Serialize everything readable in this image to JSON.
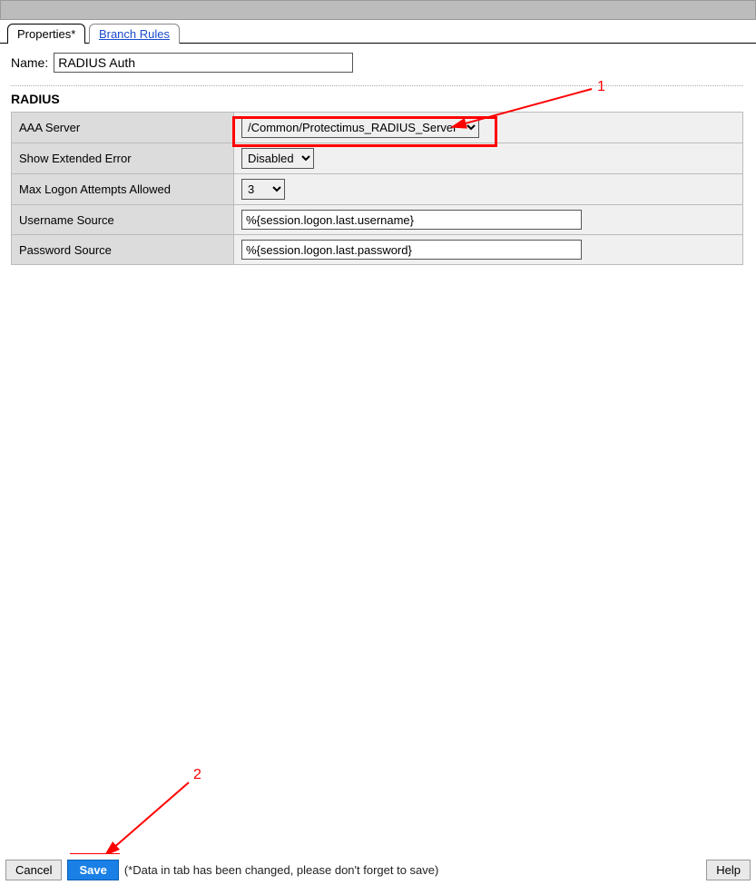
{
  "tabs": {
    "properties": "Properties*",
    "branch_rules": "Branch Rules"
  },
  "name": {
    "label": "Name:",
    "value": "RADIUS Auth"
  },
  "section": {
    "title": "RADIUS"
  },
  "fields": {
    "aaa_server": {
      "label": "AAA Server",
      "value": "/Common/Protectimus_RADIUS_Server"
    },
    "show_extended_error": {
      "label": "Show Extended Error",
      "value": "Disabled"
    },
    "max_logon_attempts": {
      "label": "Max Logon Attempts Allowed",
      "value": "3"
    },
    "username_source": {
      "label": "Username Source",
      "value": "%{session.logon.last.username}"
    },
    "password_source": {
      "label": "Password Source",
      "value": "%{session.logon.last.password}"
    }
  },
  "annotations": {
    "one": "1",
    "two": "2"
  },
  "footer": {
    "cancel": "Cancel",
    "save": "Save",
    "note": "(*Data in tab has been changed, please don't forget to save)",
    "help": "Help"
  }
}
